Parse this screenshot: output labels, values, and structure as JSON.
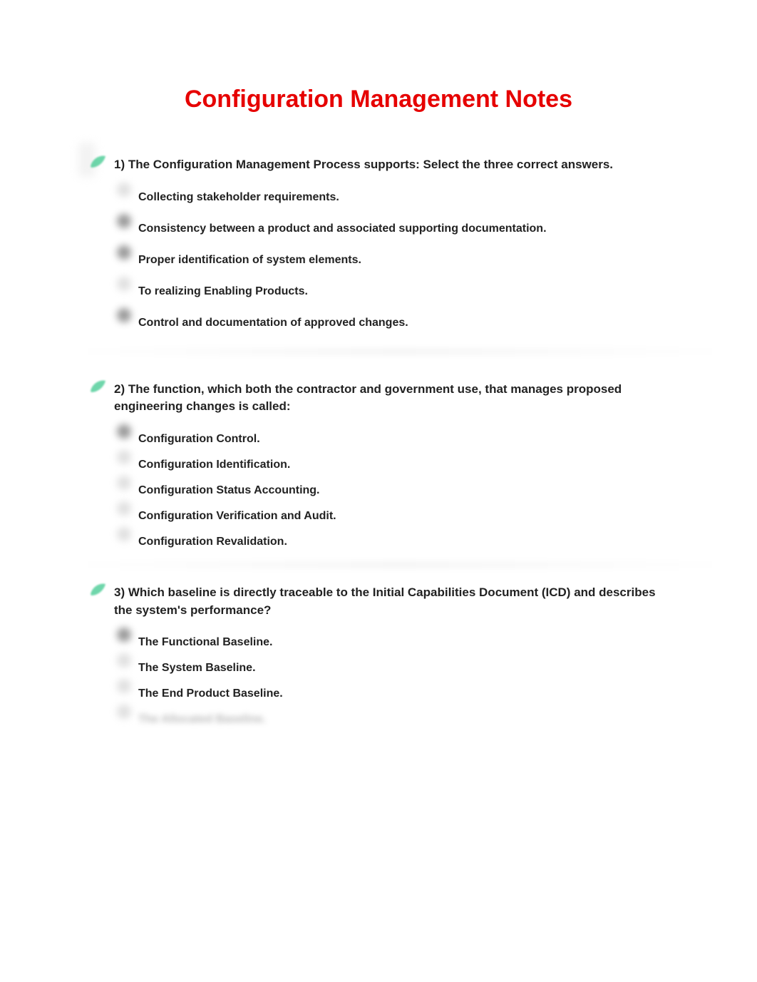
{
  "title": "Configuration Management Notes",
  "questions": [
    {
      "prompt": "1) The Configuration Management Process supports: Select the three correct answers.",
      "options": [
        {
          "text": "Collecting stakeholder requirements.",
          "filled": false
        },
        {
          "text": "Consistency between a product and associated supporting documentation.",
          "filled": true
        },
        {
          "text": "Proper identification of system elements.",
          "filled": true
        },
        {
          "text": "To realizing Enabling Products.",
          "filled": false
        },
        {
          "text": "Control and documentation of approved changes.",
          "filled": true
        }
      ],
      "spacing": "wide",
      "divider": true
    },
    {
      "prompt": "2) The function, which both the contractor and government use, that manages proposed engineering changes is called:",
      "options": [
        {
          "text": "Configuration Control.",
          "filled": true
        },
        {
          "text": "Configuration Identification.",
          "filled": false
        },
        {
          "text": "Configuration Status Accounting.",
          "filled": false
        },
        {
          "text": "Configuration Verification and Audit.",
          "filled": false
        },
        {
          "text": "Configuration Revalidation.",
          "filled": false
        }
      ],
      "spacing": "tight",
      "divider": true
    },
    {
      "prompt": "3) Which baseline is directly traceable to the Initial Capabilities Document (ICD) and describes the system's performance?",
      "options": [
        {
          "text": "The Functional Baseline.",
          "filled": true
        },
        {
          "text": "The System Baseline.",
          "filled": false
        },
        {
          "text": "The End Product Baseline.",
          "filled": false
        },
        {
          "text": "The Allocated Baseline.",
          "filled": false,
          "blurred": true
        }
      ],
      "spacing": "tight",
      "divider": false
    }
  ]
}
